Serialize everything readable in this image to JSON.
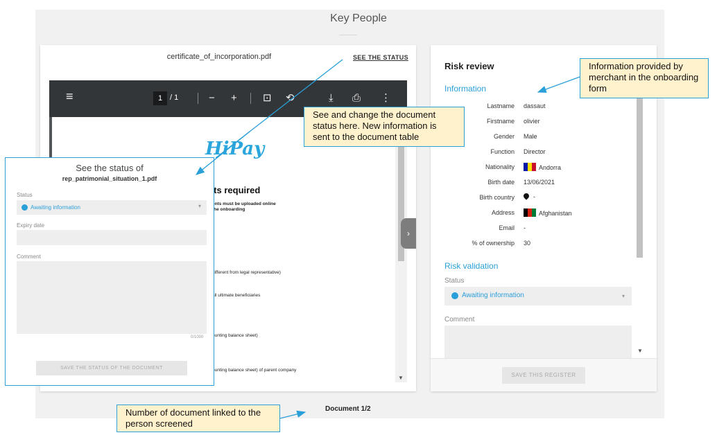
{
  "page": {
    "title": "Key People"
  },
  "document_viewer": {
    "filename": "certificate_of_incorporation.pdf",
    "see_status_link": "SEE THE STATUS",
    "toolbar": {
      "menu_icon": "≡",
      "page_current": "1",
      "page_total": "/ 1",
      "zoom_out_icon": "−",
      "zoom_in_icon": "+",
      "fit_icon": "⊡",
      "rotate_icon": "⟲",
      "download_icon": "⤓",
      "print_icon": "⎙",
      "more_icon": "⋮"
    },
    "pdf_content": {
      "logo": "HiPay",
      "heading": "ents required",
      "line1": "ents must be uploaded online",
      "line2": "the onboarding",
      "line3": "different from legal representative)",
      "line4": "all ultimate beneficiaries",
      "line5": "ounting balance sheet)",
      "line6": "ounting balance sheet) of parent company"
    },
    "side_toggle_icon": "›",
    "document_counter": "Document 1/2"
  },
  "status_panel": {
    "heading": "See the status of",
    "filename": "rep_patrimonial_situation_1.pdf",
    "status_label": "Status",
    "status_value": "Awaiting information",
    "caret": "▾",
    "expiry_label": "Expiry date",
    "comment_label": "Comment",
    "counter": "0/1000",
    "save_button": "SAVE THE STATUS OF THE DOCUMENT"
  },
  "risk_review": {
    "title": "Risk review",
    "info_heading": "Information",
    "fields": [
      {
        "label": "Lastname",
        "value": "dassaut"
      },
      {
        "label": "Firstname",
        "value": "olivier"
      },
      {
        "label": "Gender",
        "value": "Male"
      },
      {
        "label": "Function",
        "value": "Director"
      },
      {
        "label": "Nationality",
        "value": "Andorra"
      },
      {
        "label": "Birth date",
        "value": "13/06/2021"
      },
      {
        "label": "Birth country",
        "value": "-"
      },
      {
        "label": "Address",
        "value": "Afghanistan"
      },
      {
        "label": "Email",
        "value": "-"
      },
      {
        "label": "% of ownership",
        "value": "30"
      }
    ],
    "validation_heading": "Risk validation",
    "status_label": "Status",
    "status_value": "Awaiting information",
    "caret": "▾",
    "comment_label": "Comment",
    "scroll_arrow": "▼",
    "save_button": "SAVE THIS REGISTER"
  },
  "annotations": {
    "merchant_info": "Information provided by merchant in the onboarding form",
    "change_status": "See and change the document status here. New information is sent to the document table",
    "doc_count": "Number of document linked to the person screened"
  },
  "colors": {
    "accent": "#2a9fd8",
    "callout_bg": "#fff2cc",
    "toolbar_bg": "#323639"
  }
}
